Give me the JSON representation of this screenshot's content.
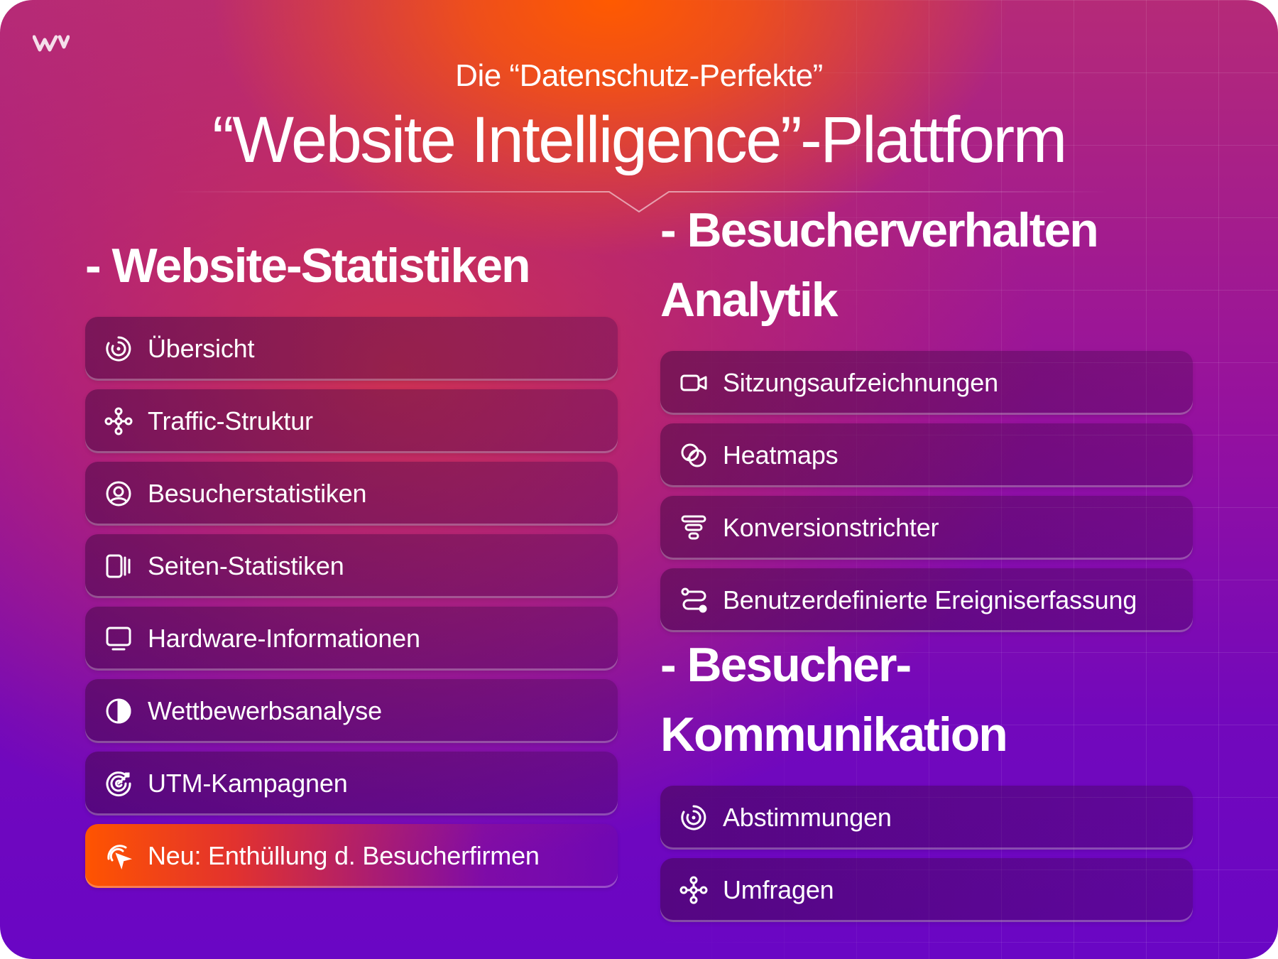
{
  "header": {
    "subtitle": "Die “Datenschutz-Perfekte”",
    "title": "“Website Intelligence”-Plattform"
  },
  "sections": {
    "website_stats": {
      "heading": "- Website-Statistiken",
      "items": [
        {
          "label": "Übersicht",
          "icon": "gauge-icon"
        },
        {
          "label": "Traffic-Struktur",
          "icon": "network-icon"
        },
        {
          "label": "Besucherstatistiken",
          "icon": "user-circle-icon"
        },
        {
          "label": "Seiten-Statistiken",
          "icon": "pages-icon"
        },
        {
          "label": "Hardware-Informationen",
          "icon": "monitor-icon"
        },
        {
          "label": "Wettbewerbsanalyse",
          "icon": "contrast-icon"
        },
        {
          "label": "UTM-Kampagnen",
          "icon": "target-icon"
        },
        {
          "label": "Neu: Enthüllung d. Besucherfirmen",
          "icon": "radar-cursor-icon"
        }
      ]
    },
    "behavior": {
      "heading_line1": "- Besucherverhalten",
      "heading_line2": "Analytik",
      "items": [
        {
          "label": "Sitzungsaufzeichnungen",
          "icon": "video-camera-icon"
        },
        {
          "label": "Heatmaps",
          "icon": "overlap-circles-icon"
        },
        {
          "label": "Konversionstrichter",
          "icon": "funnel-icon"
        },
        {
          "label": "Benutzerdefinierte Ereigniserfassung",
          "icon": "route-icon"
        }
      ]
    },
    "communication": {
      "heading_line1": "- Besucher-",
      "heading_line2": "Kommunikation",
      "items": [
        {
          "label": "Abstimmungen",
          "icon": "gauge-icon"
        },
        {
          "label": "Umfragen",
          "icon": "network-icon"
        }
      ]
    }
  },
  "colors": {
    "accent_orange": "#ff5400",
    "background_top": "#b52a78",
    "background_bottom": "#6a06c4"
  }
}
